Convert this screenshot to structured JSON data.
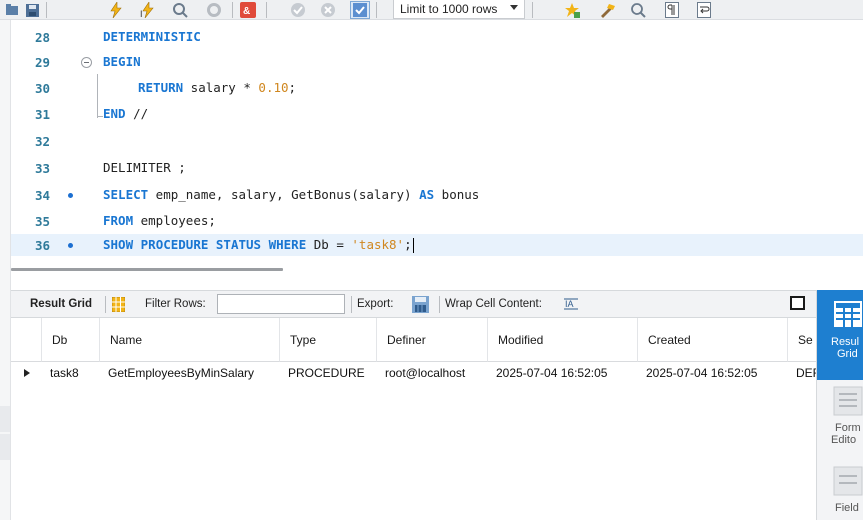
{
  "toolbar": {
    "limit_rows_label": "Limit to 1000 rows"
  },
  "editor": {
    "lines": [
      {
        "no": "28",
        "code": "DETERMINISTIC"
      },
      {
        "no": "29",
        "code": "BEGIN"
      },
      {
        "no": "30",
        "code": "RETURN salary * 0.10;"
      },
      {
        "no": "31",
        "code": "END //"
      },
      {
        "no": "32",
        "code": ""
      },
      {
        "no": "33",
        "code": "DELIMITER ;"
      },
      {
        "no": "34",
        "code": "SELECT emp_name, salary, GetBonus(salary) AS bonus"
      },
      {
        "no": "35",
        "code": "FROM employees;"
      },
      {
        "no": "36",
        "code": "SHOW PROCEDURE STATUS WHERE Db = 'task8';"
      }
    ]
  },
  "result_toolbar": {
    "result_grid": "Result Grid",
    "filter_rows": "Filter Rows:",
    "filter_value": "",
    "export": "Export:",
    "wrap_cell_content": "Wrap Cell Content:"
  },
  "grid": {
    "columns": [
      "Db",
      "Name",
      "Type",
      "Definer",
      "Modified",
      "Created",
      "Se"
    ],
    "rows": [
      [
        "task8",
        "GetEmployeesByMinSalary",
        "PROCEDURE",
        "root@localhost",
        "2025-07-04 16:52:05",
        "2025-07-04 16:52:05",
        "DEF"
      ]
    ]
  },
  "side_panel": {
    "result_grid": [
      "Resul",
      "Grid"
    ],
    "form_editor": [
      "Form",
      "Edito"
    ],
    "field_types": [
      "Field"
    ]
  },
  "colors": {
    "keyword": "#1976d2",
    "string": "#d0871f",
    "line_number": "#2f7a9a",
    "active_side": "#1e7fd0"
  }
}
